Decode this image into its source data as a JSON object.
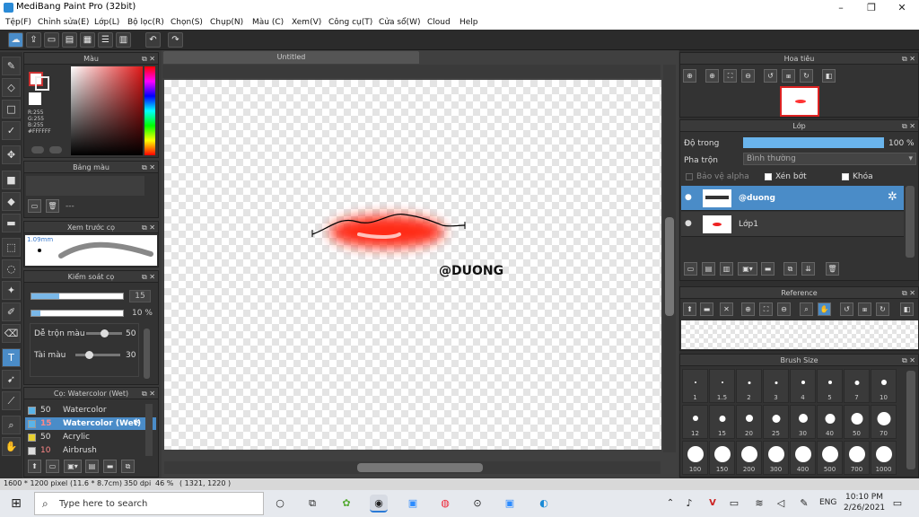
{
  "window": {
    "title": "MediBang Paint Pro (32bit)",
    "minimize": "–",
    "restore": "❐",
    "close": "✕"
  },
  "menu": [
    "Tệp(F)",
    "Chỉnh sửa(E)",
    "Lớp(L)",
    "Bộ lọc(R)",
    "Chọn(S)",
    "Chụp(N)",
    "Màu (C)",
    "Xem(V)",
    "Công cụ(T)",
    "Cửa sổ(W)",
    "Cloud",
    "Help"
  ],
  "document": {
    "tab_title": "Untitled"
  },
  "canvas": {
    "watermark": "@DUONG",
    "lip_color": "#ff2a12"
  },
  "color_panel": {
    "title": "Màu",
    "r": "R:255",
    "g": "G:255",
    "b": "B:255",
    "hex": "#FFFFFF",
    "main": "#e02020"
  },
  "palette_panel": {
    "title": "Bảng màu",
    "hint": "---"
  },
  "preview_panel": {
    "title": "Xem trước cọ",
    "size": "1.09mm"
  },
  "brush_control": {
    "title": "Kiểm soát cọ",
    "size_value": "15",
    "opacity_value": "10 %",
    "mix_label": "Dễ trộn màu",
    "mix_value": "50",
    "ink_label": "Tài màu",
    "ink_value": "30",
    "size_fraction": 0.3,
    "opacity_fraction": 0.1,
    "mix_fraction": 0.5,
    "ink_fraction": 0.3
  },
  "brush_list": {
    "title": "Cọ: Watercolor (Wet)",
    "items": [
      {
        "size": "50",
        "name": "Watercolor",
        "selected": false,
        "sw": "#5ab4e8"
      },
      {
        "size": "15",
        "name": "Watercolor (Wet)",
        "selected": true,
        "sw": "#5ab4e8"
      },
      {
        "size": "50",
        "name": "Acrylic",
        "selected": false,
        "sw": "#e8d030"
      },
      {
        "size": "10",
        "name": "Airbrush",
        "selected": false,
        "sw": "#dddddd"
      }
    ]
  },
  "navigator": {
    "title": "Hoa tiêu"
  },
  "layers": {
    "title": "Lớp",
    "opacity_label": "Độ trong",
    "opacity_value": "100 %",
    "opacity_fraction": 1.0,
    "blend_label": "Pha trộn",
    "blend_value": "Bình thường",
    "protect_alpha": "Bảo vệ alpha",
    "clipping": "Xén bớt",
    "lock": "Khóa",
    "items": [
      {
        "name": "@duong",
        "selected": true
      },
      {
        "name": "Lớp1",
        "selected": false
      }
    ]
  },
  "reference": {
    "title": "Reference"
  },
  "brush_size": {
    "title": "Brush Size",
    "sizes": [
      "1",
      "1.5",
      "2",
      "3",
      "4",
      "5",
      "7",
      "10",
      "12",
      "15",
      "20",
      "25",
      "30",
      "40",
      "50",
      "70",
      "100",
      "150",
      "200",
      "300",
      "400",
      "500",
      "700",
      "1000"
    ]
  },
  "status": {
    "dims": "1600 * 1200 pixel",
    "physical": "(11.6 * 8.7cm)",
    "dpi": "350 dpi",
    "zoom": "46 %",
    "coords": "( 1321, 1220 )"
  },
  "taskbar": {
    "search_placeholder": "Type here to search",
    "time": "10:10 PM",
    "date": "2/26/2021",
    "lang": "ENG"
  }
}
